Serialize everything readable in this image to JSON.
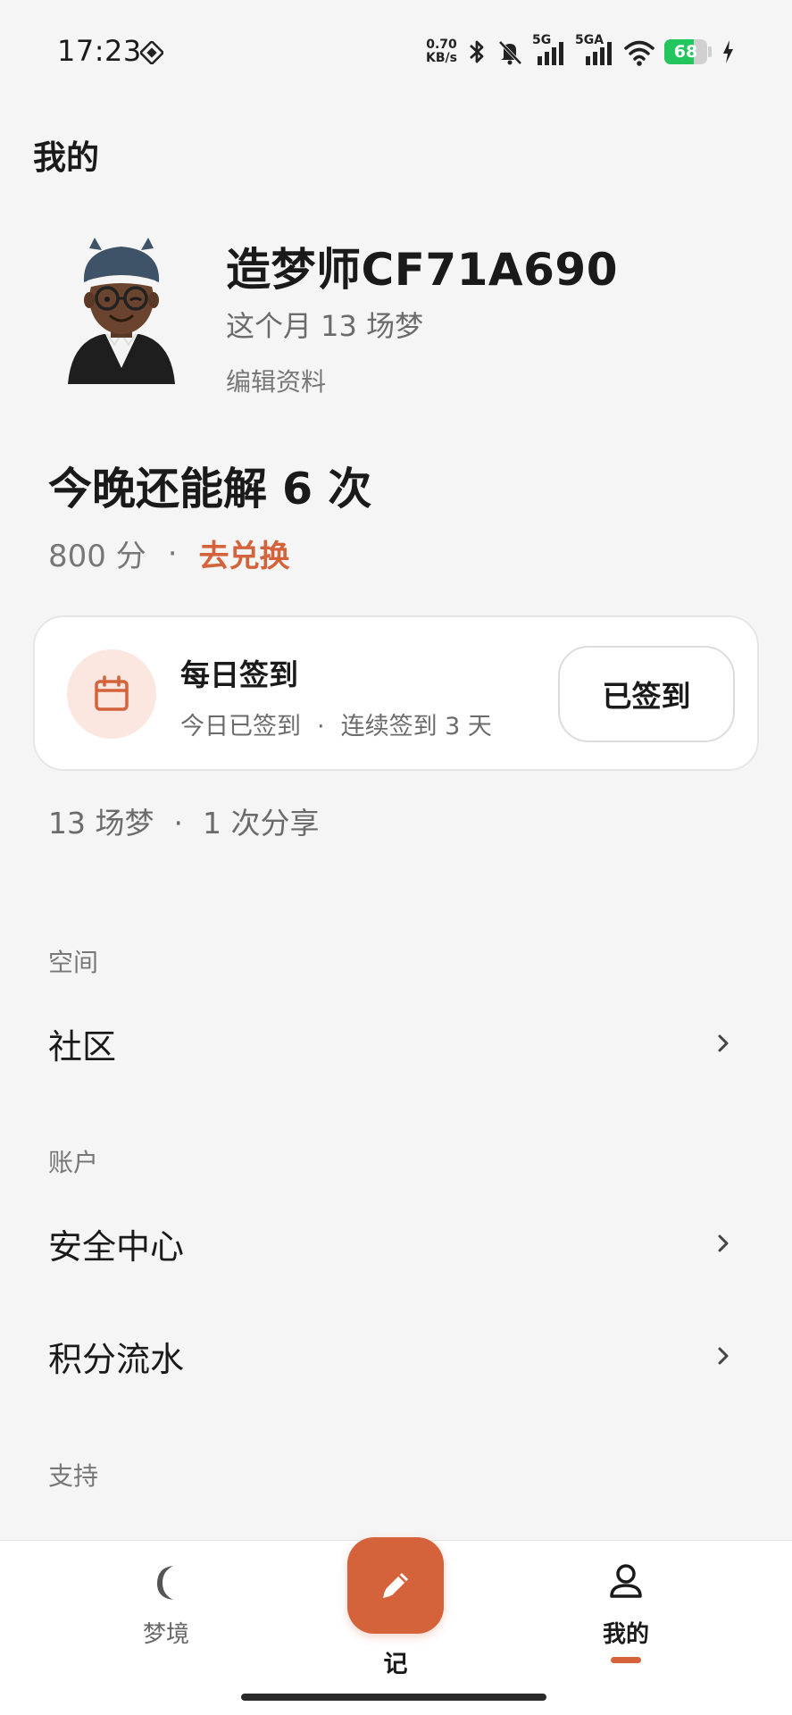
{
  "status_bar": {
    "time": "17:23",
    "net_speed_value": "0.70",
    "net_speed_unit": "KB/s",
    "signal1_label": "5G",
    "signal2_label": "5GA",
    "battery_level": "68",
    "battery_fraction": 0.68,
    "battery_color": "#22c55e",
    "icons": [
      "diamond-icon",
      "bluetooth-icon",
      "mute-bell-icon",
      "signal-icon",
      "wifi-icon",
      "battery-icon",
      "charging-icon"
    ]
  },
  "page": {
    "title": "我的"
  },
  "profile": {
    "username": "造梦师CF71A690",
    "monthly_dreams": "这个月 13 场梦",
    "edit_label": "编辑资料"
  },
  "interpretation": {
    "remaining": "今晚还能解 6 次",
    "points": "800 分",
    "separator": "·",
    "redeem_label": "去兑换"
  },
  "checkin": {
    "title": "每日签到",
    "status": "今日已签到",
    "separator": "·",
    "streak": "连续签到 3 天",
    "button_label": "已签到"
  },
  "stats": {
    "dreams": "13 场梦",
    "separator": "·",
    "shares": "1 次分享"
  },
  "sections": {
    "space": {
      "label": "空间",
      "items": [
        {
          "label": "社区"
        }
      ]
    },
    "account": {
      "label": "账户",
      "items": [
        {
          "label": "安全中心"
        },
        {
          "label": "积分流水"
        }
      ]
    },
    "support": {
      "label": "支持"
    }
  },
  "bottom_nav": {
    "dreams_label": "梦境",
    "record_label": "记",
    "me_label": "我的",
    "accent_color": "#d4623a"
  }
}
